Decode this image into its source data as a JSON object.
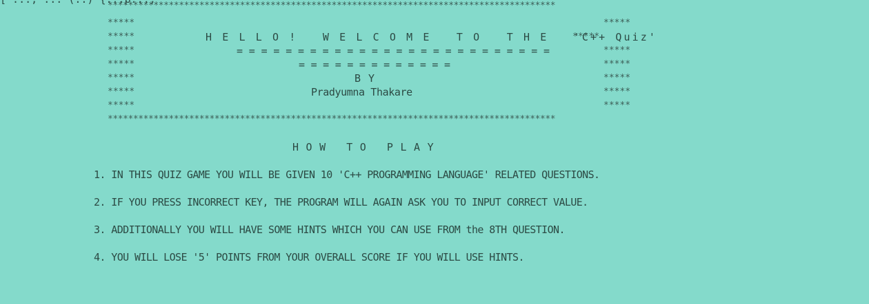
{
  "console": {
    "cutoff_line": "[ ...; ... (..) {...p...;",
    "banner": {
      "border": "****************************************************************************************",
      "side_left": "*****",
      "side_right": "*****",
      "title": "H E L L O !   W E L C O M E   T O   T H E   'C++ Quiz'",
      "title_right": "*****",
      "underline_1": "= = = = = = = = = = = = = = = = = = = = = = = = = =",
      "underline_2": "= = = = = = = = = = = = =",
      "by": "B Y",
      "author": "Pradyumna Thakare"
    },
    "how_to_play": {
      "heading": "H O W   T O   P L A Y",
      "items": [
        "1. IN THIS QUIZ GAME YOU WILL BE GIVEN 10 'C++ PROGRAMMING LANGUAGE' RELATED QUESTIONS.",
        "2. IF YOU PRESS INCORRECT KEY, THE PROGRAM WILL AGAIN ASK YOU TO INPUT CORRECT VALUE.",
        "3. ADDITIONALLY YOU WILL HAVE SOME HINTS WHICH YOU CAN USE FROM the 8TH QUESTION.",
        "4. YOU WILL LOSE '5' POINTS FROM YOUR OVERALL SCORE IF YOU WILL USE HINTS."
      ]
    }
  }
}
